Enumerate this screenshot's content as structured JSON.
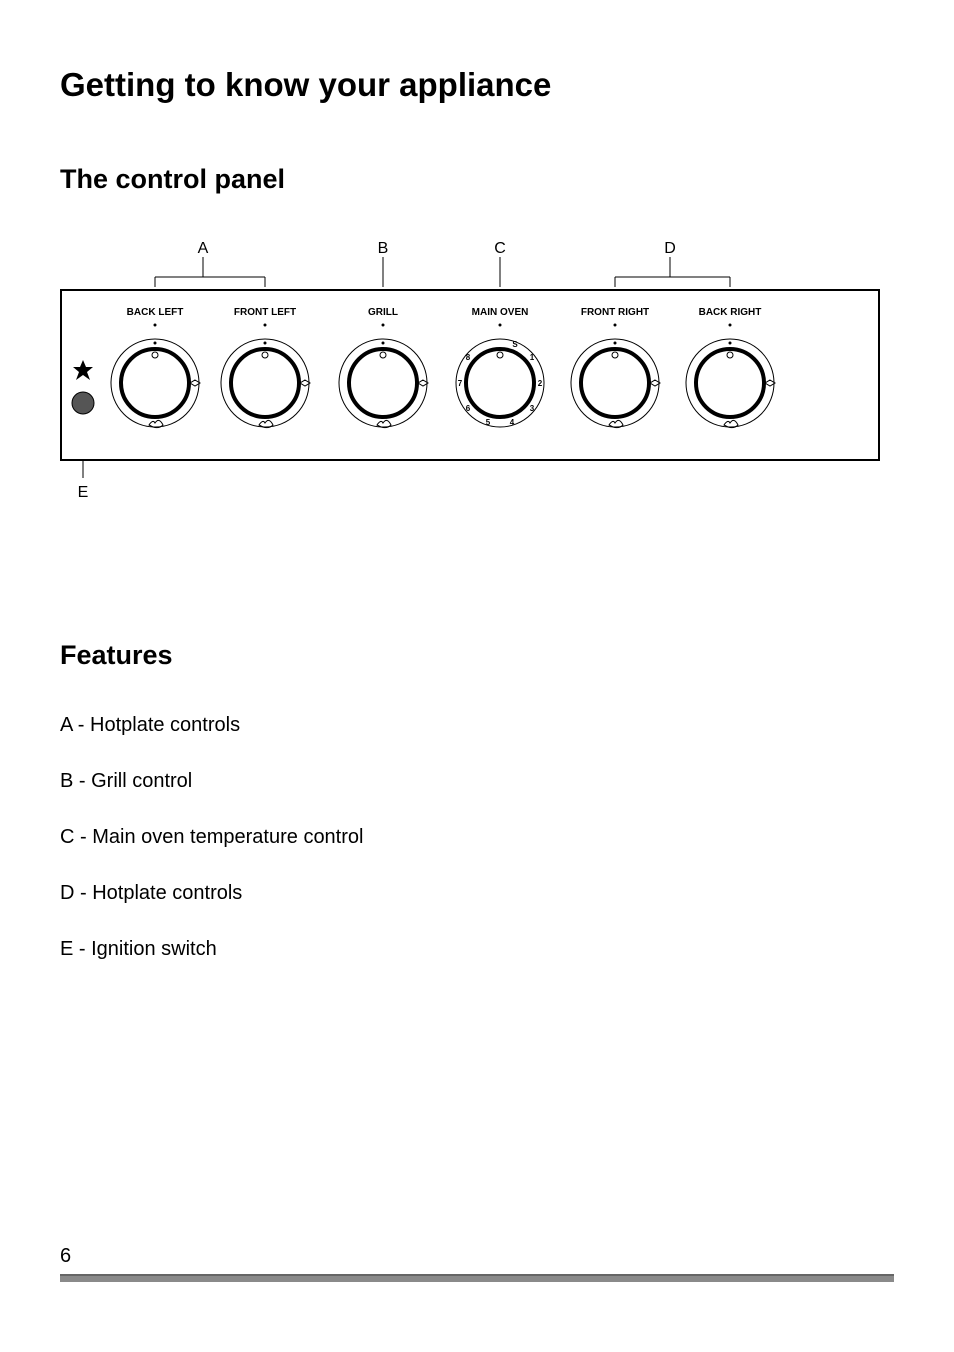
{
  "title": "Getting to know your appliance",
  "section1_title": "The control panel",
  "section2_title": "Features",
  "page_number": "6",
  "diagram": {
    "callouts": {
      "A": "A",
      "B": "B",
      "C": "C",
      "D": "D",
      "E": "E"
    },
    "knob_labels": {
      "back_left": "BACK LEFT",
      "front_left": "FRONT LEFT",
      "grill": "GRILL",
      "main_oven": "MAIN OVEN",
      "front_right": "FRONT RIGHT",
      "back_right": "BACK RIGHT"
    },
    "main_oven_numbers": [
      "1",
      "2",
      "3",
      "4",
      "5",
      "6",
      "7",
      "8",
      "S"
    ]
  },
  "features": [
    "A - Hotplate controls",
    "B - Grill control",
    "C - Main oven temperature control",
    "D - Hotplate controls",
    "E - Ignition switch"
  ]
}
